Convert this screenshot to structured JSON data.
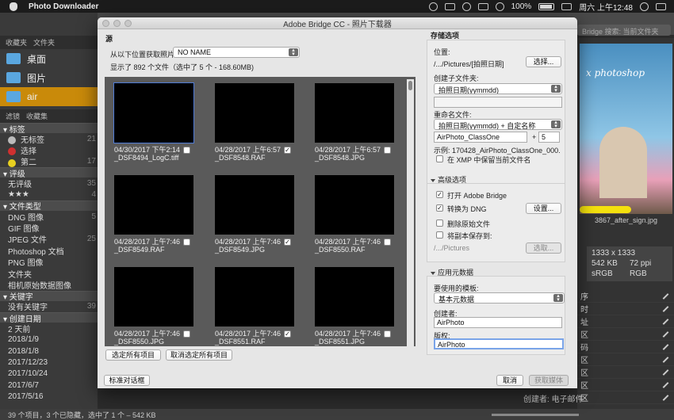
{
  "menubar": {
    "app_name": "Photo Downloader",
    "status_items": [
      "100%",
      "周六 上午12:48"
    ]
  },
  "bridge": {
    "search_placeholder": "Bridge 搜索: 当前文件夹",
    "left_tabs": [
      "收藏夹",
      "文件夹"
    ],
    "favorites": [
      {
        "label": "桌面"
      },
      {
        "label": "图片"
      },
      {
        "label": "air"
      }
    ],
    "filter_tabs": [
      "滤镜",
      "收藏集"
    ],
    "filters": [
      {
        "type": "head",
        "label": "标签"
      },
      {
        "type": "row",
        "label": "无标签",
        "count": "21",
        "dot": "#bbbbbb"
      },
      {
        "type": "row",
        "label": "选择",
        "count": "",
        "dot": "#d03030"
      },
      {
        "type": "row",
        "label": "第二",
        "count": "17",
        "dot": "#e8d020"
      },
      {
        "type": "head",
        "label": "评级"
      },
      {
        "type": "row",
        "label": "无评级",
        "count": "35"
      },
      {
        "type": "row",
        "label": "★★★",
        "count": "4"
      },
      {
        "type": "head",
        "label": "文件类型"
      },
      {
        "type": "row",
        "label": "DNG 图像",
        "count": "5"
      },
      {
        "type": "row",
        "label": "GIF 图像",
        "count": ""
      },
      {
        "type": "row",
        "label": "JPEG 文件",
        "count": "25"
      },
      {
        "type": "row",
        "label": "Photoshop 文档",
        "count": ""
      },
      {
        "type": "row",
        "label": "PNG 图像",
        "count": ""
      },
      {
        "type": "row",
        "label": "文件夹",
        "count": ""
      },
      {
        "type": "row",
        "label": "相机原始数据图像",
        "count": ""
      },
      {
        "type": "head",
        "label": "关键字"
      },
      {
        "type": "row",
        "label": "没有关键字",
        "count": "39"
      },
      {
        "type": "head",
        "label": "创建日期"
      },
      {
        "type": "row",
        "label": "2 天前",
        "count": ""
      },
      {
        "type": "row",
        "label": "2018/1/9",
        "count": ""
      },
      {
        "type": "row",
        "label": "2018/1/8",
        "count": ""
      },
      {
        "type": "row",
        "label": "2017/12/23",
        "count": ""
      },
      {
        "type": "row",
        "label": "2017/10/24",
        "count": ""
      },
      {
        "type": "row",
        "label": "2017/6/7",
        "count": ""
      },
      {
        "type": "row",
        "label": "2017/5/16",
        "count": ""
      }
    ],
    "preview_caption": "3867_after_sign.jpg",
    "meta_box": [
      "1333 x 1333",
      "542 KB",
      "72 ppi",
      "sRGB",
      "RGB"
    ],
    "meta_list": [
      "序",
      "时",
      "址",
      "区",
      "码",
      "区",
      "区",
      "区",
      "区"
    ],
    "bottom_status": "39 个项目，3 个已隐藏，选中了 1 个 – 542 KB",
    "creator_label": "创建者: 电子邮件"
  },
  "dialog": {
    "title": "Adobe Bridge CC - 照片下载器",
    "source_label": "源",
    "get_photos_from_label": "从以下位置获取照片：",
    "source_device": "NO NAME",
    "file_info": "显示了 892 个文件（选中了 5 个 - 168.60MB)",
    "thumbnails": [
      {
        "date": "04/30/2017 下午2:14",
        "name": "_DSF8494_LogC.tiff",
        "checked": false,
        "selected": true
      },
      {
        "date": "04/28/2017 上午6:57",
        "name": "_DSF8548.RAF",
        "checked": true,
        "selected": false
      },
      {
        "date": "04/28/2017 上午6:57",
        "name": "_DSF8548.JPG",
        "checked": false,
        "selected": false
      },
      {
        "date": "04/28/2017 上午7:46",
        "name": "_DSF8549.RAF",
        "checked": false,
        "selected": false
      },
      {
        "date": "04/28/2017 上午7:46",
        "name": "_DSF8549.JPG",
        "checked": true,
        "selected": false
      },
      {
        "date": "04/28/2017 上午7:46",
        "name": "_DSF8550.RAF",
        "checked": false,
        "selected": false
      },
      {
        "date": "04/28/2017 上午7:46",
        "name": "_DSF8550.JPG",
        "checked": false,
        "selected": false
      },
      {
        "date": "04/28/2017 上午7:46",
        "name": "_DSF8551.RAF",
        "checked": true,
        "selected": false
      },
      {
        "date": "04/28/2017 上午7:46",
        "name": "_DSF8551.JPG",
        "checked": false,
        "selected": false
      }
    ],
    "select_all": "选定所有项目",
    "deselect_all": "取消选定所有项目",
    "standard_dialog": "标准对话框",
    "cancel": "取消",
    "get_media": "获取媒体",
    "save_options": {
      "heading": "存储选项",
      "location_label": "位置:",
      "location_path": "/.../Pictures/[拍照日期]",
      "choose_button": "选择...",
      "create_subfolder_label": "创建子文件夹:",
      "subfolder_value": "拍照日期(yymmdd)",
      "rename_label": "重命名文件:",
      "rename_value": "拍照日期(yymmdd) + 自定名称",
      "custom_name": "AirPhoto_ClassOne",
      "plus": "+",
      "sequence": "5",
      "example": "示例: 170428_AirPhoto_ClassOne_000...",
      "preserve_xmp": "在 XMP 中保留当前文件名",
      "preserve_xmp_checked": false
    },
    "advanced": {
      "heading": "高级选项",
      "open_bridge": "打开 Adobe Bridge",
      "open_bridge_checked": true,
      "convert_dng": "转换为 DNG",
      "convert_dng_checked": true,
      "settings_button": "设置...",
      "delete_originals": "删除原始文件",
      "delete_originals_checked": false,
      "save_copies": "将副本保存到:",
      "save_copies_checked": false,
      "copies_path": "/.../Pictures",
      "choose_disabled": "选取..."
    },
    "metadata": {
      "heading": "应用元数据",
      "template_label": "要使用的模板:",
      "template_value": "基本元数据",
      "creator_label": "创建者:",
      "creator_value": "AirPhoto",
      "copyright_label": "版权:",
      "copyright_value": "AirPhoto"
    }
  }
}
